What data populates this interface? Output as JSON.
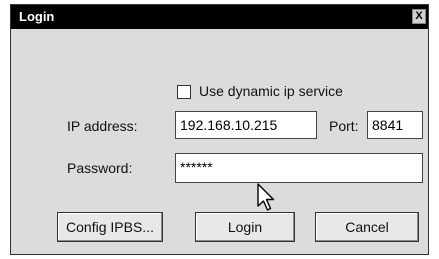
{
  "window": {
    "title": "Login",
    "close_label": "X"
  },
  "checkbox": {
    "label": "Use dynamic ip service",
    "checked": false
  },
  "fields": {
    "ip_label": "IP address:",
    "ip_value": "192.168.10.215",
    "port_label": "Port:",
    "port_value": "8841",
    "password_label": "Password:",
    "password_value": "******"
  },
  "buttons": {
    "config": "Config IPBS...",
    "login": "Login",
    "cancel": "Cancel"
  },
  "icons": {
    "cursor": "mouse-pointer-icon"
  }
}
